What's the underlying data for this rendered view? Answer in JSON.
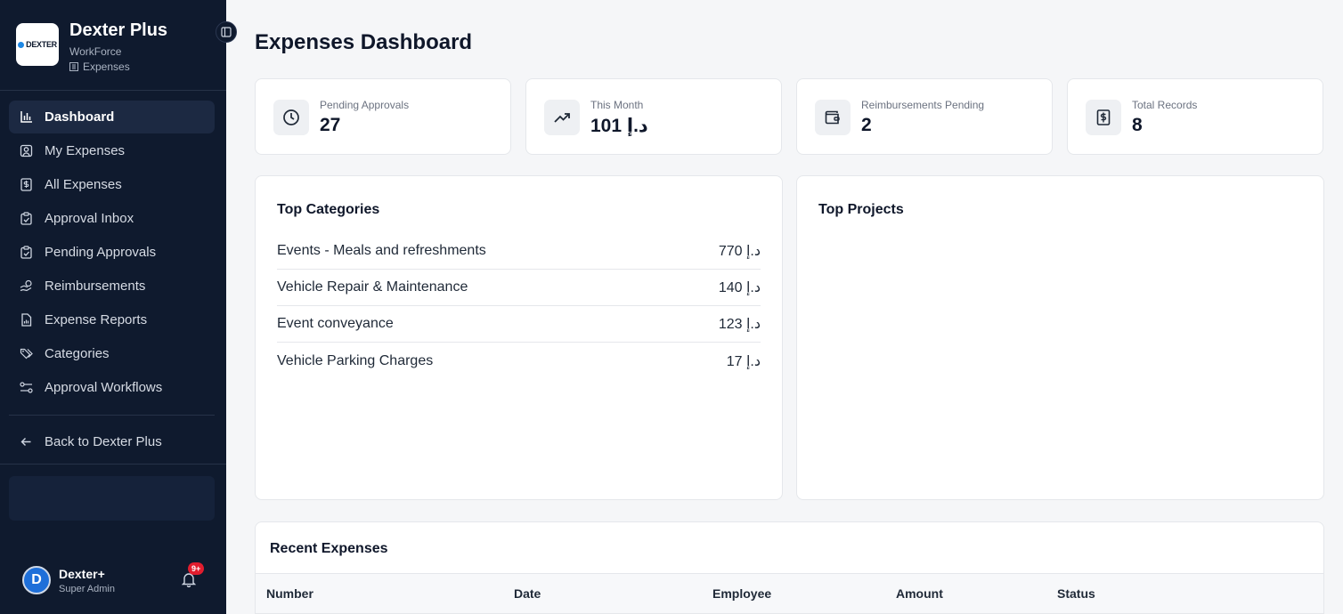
{
  "sidebar": {
    "brand": {
      "logo_text": "DEXTER",
      "title": "Dexter Plus",
      "subtitle": "WorkForce",
      "module": "Expenses"
    },
    "items": [
      {
        "label": "Dashboard",
        "icon": "bar-chart-icon",
        "active": true
      },
      {
        "label": "My Expenses",
        "icon": "user-square-icon"
      },
      {
        "label": "All Expenses",
        "icon": "dollar-file-icon"
      },
      {
        "label": "Approval Inbox",
        "icon": "clipboard-check-icon"
      },
      {
        "label": "Pending Approvals",
        "icon": "clipboard-clock-icon"
      },
      {
        "label": "Reimbursements",
        "icon": "hand-coins-icon"
      },
      {
        "label": "Expense Reports",
        "icon": "file-chart-icon"
      },
      {
        "label": "Categories",
        "icon": "tags-icon"
      },
      {
        "label": "Approval Workflows",
        "icon": "workflow-icon"
      }
    ],
    "back_label": "Back to Dexter Plus",
    "user": {
      "initial": "D",
      "name": "Dexter+",
      "role": "Super Admin"
    },
    "notifications_badge": "9+"
  },
  "main": {
    "title": "Expenses Dashboard",
    "stats": [
      {
        "label": "Pending Approvals",
        "value": "27",
        "icon": "clock-icon"
      },
      {
        "label": "This Month",
        "value": "د.إ 101",
        "icon": "trending-up-icon"
      },
      {
        "label": "Reimbursements Pending",
        "value": "2",
        "icon": "wallet-icon"
      },
      {
        "label": "Total Records",
        "value": "8",
        "icon": "receipt-dollar-icon"
      }
    ],
    "top_categories": {
      "title": "Top Categories",
      "rows": [
        {
          "name": "Events - Meals and refreshments",
          "amount": "د.إ 770"
        },
        {
          "name": "Vehicle Repair & Maintenance",
          "amount": "د.إ 140"
        },
        {
          "name": "Event conveyance",
          "amount": "د.إ 123"
        },
        {
          "name": "Vehicle Parking Charges",
          "amount": "د.إ 17"
        }
      ]
    },
    "top_projects": {
      "title": "Top Projects"
    },
    "recent_expenses": {
      "title": "Recent Expenses",
      "columns": [
        "Number",
        "Date",
        "Employee",
        "Amount",
        "Status"
      ]
    }
  },
  "colors": {
    "sidebar_bg": "#0f1a2e",
    "active_item_bg": "#1c2942",
    "badge": "#e11d2e",
    "avatar": "#1e6fd9"
  }
}
